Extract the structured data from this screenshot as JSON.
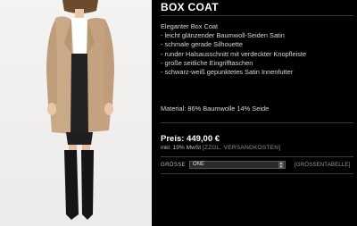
{
  "product": {
    "title": "BOX COAT",
    "description": [
      "Eleganter Box Coat",
      "- leicht glänzender Baumwoll-Seiden Satin",
      "- schmale gerade Silhouette",
      "- runder Halsausschnitt mit verdeckter Knopfleiste",
      "- große seitliche Eingrifftaschen",
      "- schwarz-weiß gepunktetes Satin Innenfutter"
    ],
    "material": "Material: 86% Baumwolle 14% Seide",
    "price": "Preis: 449,00 €",
    "vat_text": "inkl. 19% MwSt",
    "shipping_link": "[ZZGL. VERSANDKOSTEN]",
    "size_label": "GRÖSSE",
    "size_selected": "ONE",
    "size_table_link": "[GRÖSSENTABELLE]"
  },
  "colors": {
    "background": "#000000",
    "photo_background": "#efeeec",
    "coat": "#c9a987"
  },
  "icons": {
    "select_arrow": "chevron-updown-icon"
  }
}
